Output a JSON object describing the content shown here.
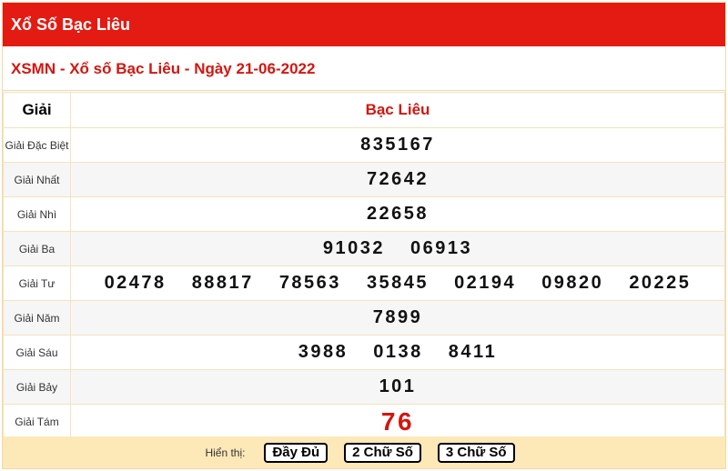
{
  "header": {
    "title": "Xổ Số Bạc Liêu"
  },
  "subtitle": "XSMN - Xổ số Bạc Liêu - Ngày 21-06-2022",
  "table": {
    "col_prize": "Giải",
    "col_province": "Bạc Liêu",
    "rows": [
      {
        "label": "Giải Đặc Biệt",
        "numbers": [
          "835167"
        ]
      },
      {
        "label": "Giải Nhất",
        "numbers": [
          "72642"
        ]
      },
      {
        "label": "Giải Nhì",
        "numbers": [
          "22658"
        ]
      },
      {
        "label": "Giải Ba",
        "numbers": [
          "91032",
          "06913"
        ]
      },
      {
        "label": "Giải Tư",
        "numbers": [
          "02478",
          "88817",
          "78563",
          "35845",
          "02194",
          "09820",
          "20225"
        ]
      },
      {
        "label": "Giải Năm",
        "numbers": [
          "7899"
        ]
      },
      {
        "label": "Giải Sáu",
        "numbers": [
          "3988",
          "0138",
          "8411"
        ]
      },
      {
        "label": "Giải Bảy",
        "numbers": [
          "101"
        ]
      },
      {
        "label": "Giải Tám",
        "numbers": [
          "76"
        ]
      }
    ]
  },
  "footer": {
    "label": "Hiển thị:",
    "full": "Đầy Đủ",
    "two_digits": "2 Chữ Số",
    "three_digits": "3 Chữ Số"
  },
  "colors": {
    "header_bg": "#e31b12",
    "accent_red": "#d4160f",
    "footer_bg": "#fde8b8"
  }
}
